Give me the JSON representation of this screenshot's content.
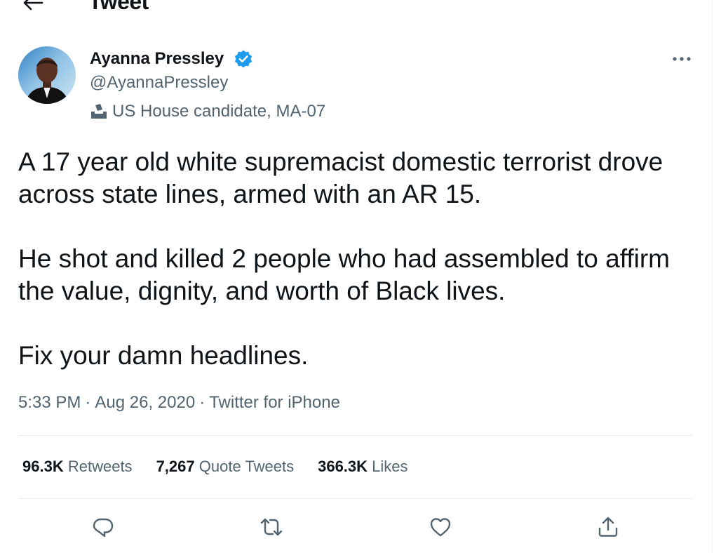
{
  "header": {
    "title": "Tweet"
  },
  "author": {
    "name": "Ayanna Pressley",
    "handle": "@AyannaPressley",
    "label": "US House candidate, MA-07"
  },
  "tweet": {
    "paragraphs": [
      "A 17 year old white supremacist domestic terrorist drove across state lines, armed with an AR 15.",
      "He shot and killed 2 people who had assembled to affirm the value, dignity, and worth of Black lives.",
      "Fix your damn headlines."
    ]
  },
  "meta": {
    "time": "5:33 PM",
    "date": "Aug 26, 2020",
    "source": "Twitter for iPhone",
    "separator": "·"
  },
  "stats": {
    "retweets_count": "96.3K",
    "retweets_label": "Retweets",
    "quotes_count": "7,267",
    "quotes_label": "Quote Tweets",
    "likes_count": "366.3K",
    "likes_label": "Likes"
  },
  "icons": {
    "back": "arrow-left-icon",
    "verified": "verified-badge-icon",
    "label": "ballot-box-icon",
    "more": "more-dots-icon",
    "reply": "reply-icon",
    "retweet": "retweet-icon",
    "like": "heart-icon",
    "share": "share-icon"
  },
  "colors": {
    "accent": "#1d9bf0",
    "secondary_text": "#536471",
    "text": "#0f1419"
  }
}
